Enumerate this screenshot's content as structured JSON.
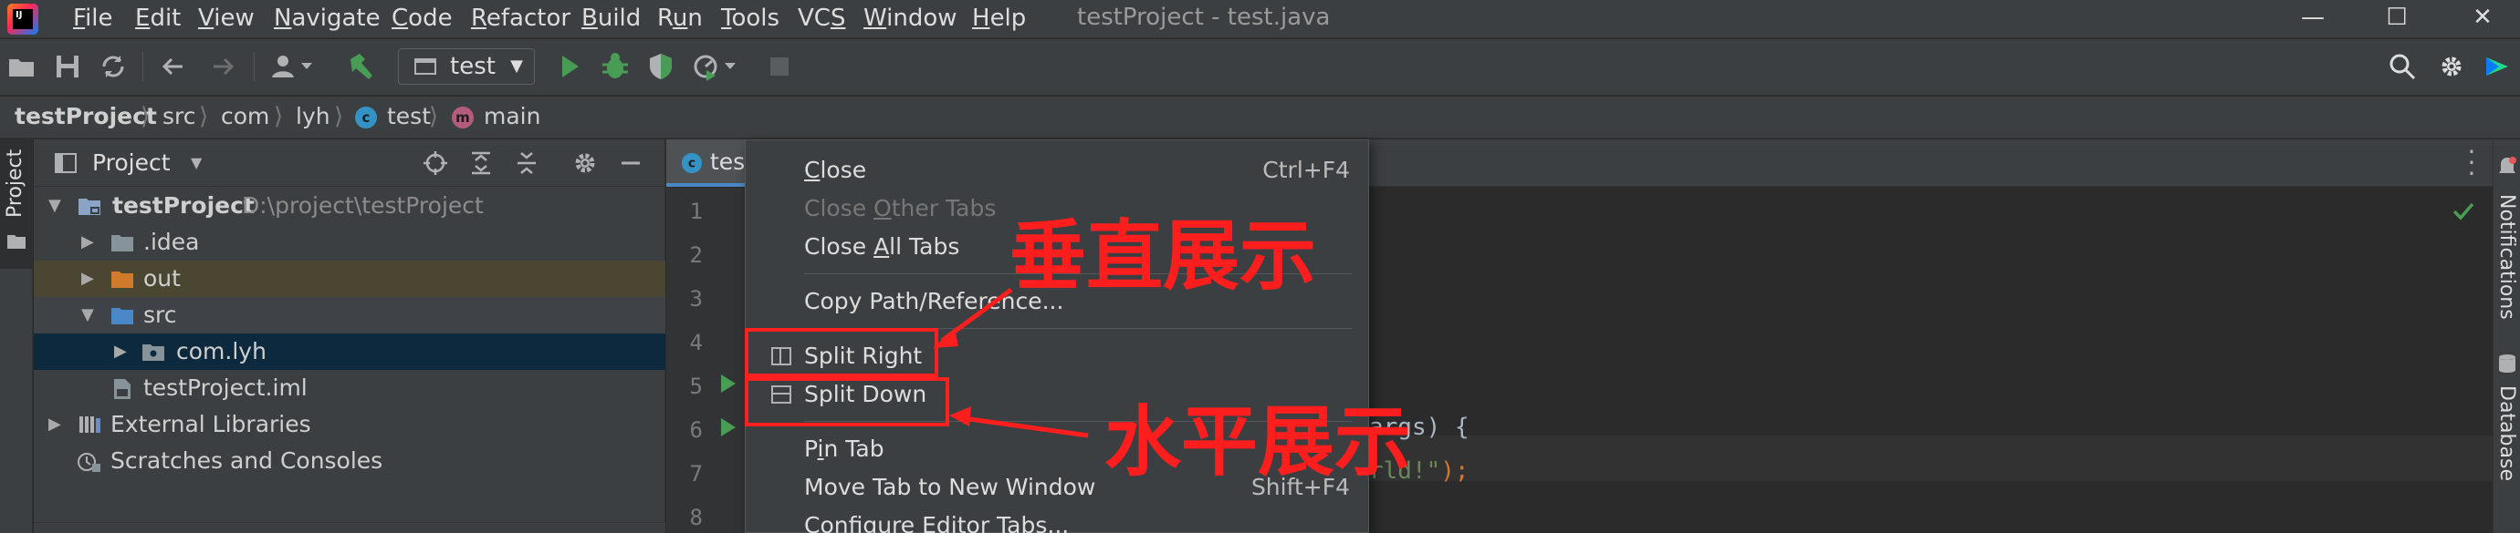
{
  "menu": {
    "items": [
      {
        "pre": "",
        "u": "F",
        "post": "ile"
      },
      {
        "pre": "",
        "u": "E",
        "post": "dit"
      },
      {
        "pre": "",
        "u": "V",
        "post": "iew"
      },
      {
        "pre": "",
        "u": "N",
        "post": "avigate"
      },
      {
        "pre": "",
        "u": "C",
        "post": "ode"
      },
      {
        "pre": "",
        "u": "R",
        "post": "efactor"
      },
      {
        "pre": "",
        "u": "B",
        "post": "uild"
      },
      {
        "pre": "R",
        "u": "u",
        "post": "n"
      },
      {
        "pre": "",
        "u": "T",
        "post": "ools"
      },
      {
        "pre": "VC",
        "u": "S",
        "post": ""
      },
      {
        "pre": "",
        "u": "W",
        "post": "indow"
      },
      {
        "pre": "",
        "u": "H",
        "post": "elp"
      }
    ]
  },
  "window": {
    "title": "testProject - test.java",
    "logo_text": "IJ"
  },
  "toolbar": {
    "run_config": "test"
  },
  "breadcrumb": [
    "testProject",
    "src",
    "com",
    "lyh",
    "test",
    "main"
  ],
  "left_strip": {
    "label": "Project"
  },
  "right_strip": {
    "notifications": "Notifications",
    "database": "Database"
  },
  "project": {
    "title": "Project",
    "tree": [
      {
        "label": "testProject",
        "path": "D:\\project\\testProject"
      },
      {
        "label": ".idea"
      },
      {
        "label": "out"
      },
      {
        "label": "src"
      },
      {
        "label": "com.lyh"
      },
      {
        "label": "testProject.iml"
      },
      {
        "label": "External Libraries"
      },
      {
        "label": "Scratches and Consoles"
      }
    ]
  },
  "editor": {
    "tab": "tes",
    "line_numbers": [
      "1",
      "2",
      "3",
      "4",
      "5",
      "6",
      "7",
      "8"
    ],
    "code": {
      "line6_text": "args) {",
      "line7_str": "rld!\"",
      "line7_rest": ");"
    }
  },
  "context_menu": {
    "items": [
      {
        "pre": "",
        "u": "C",
        "post": "lose",
        "shortcut": "Ctrl+F4"
      },
      {
        "pre": "Close ",
        "u": "O",
        "post": "ther Tabs",
        "disabled": true
      },
      {
        "pre": "Close ",
        "u": "A",
        "post": "ll Tabs"
      },
      {
        "pre": "Copy Path/Reference...",
        "u": "",
        "post": ""
      },
      {
        "pre": "Split Right",
        "u": "",
        "post": ""
      },
      {
        "pre": "Split Down",
        "u": "",
        "post": ""
      },
      {
        "pre": "P",
        "u": "i",
        "post": "n Tab"
      },
      {
        "pre": "Move Tab to New Window",
        "u": "",
        "post": "",
        "shortcut": "Shift+F4"
      },
      {
        "pre": "Configure Editor Tabs...",
        "u": "",
        "post": ""
      }
    ]
  },
  "annotations": {
    "vertical": "垂直展示",
    "horizontal": "水平展示",
    "color": "#ff1e1e"
  }
}
